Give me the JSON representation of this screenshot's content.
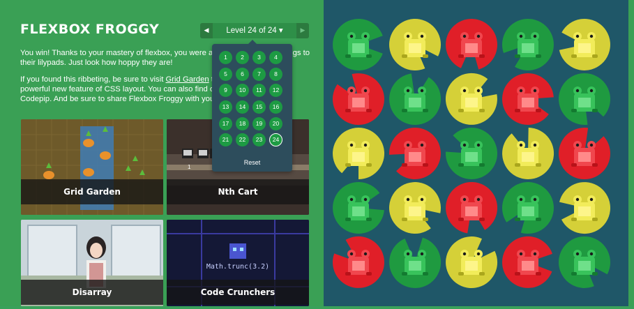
{
  "app": {
    "title": "FLEXBOX FROGGY"
  },
  "intro": {
    "p1": "You win! Thanks to your mastery of flexbox, you were able to help all of the frogs to their lilypads. Just look how hoppy they are!",
    "p2_before": "If you found this ribbeting, be sure to visit ",
    "p2_link": "Grid Garden",
    "p2_after": " to learn about another powerful new feature of CSS layout. You can also find other coding games at Codepip. And be sure to share Flexbox Froggy with your friends!"
  },
  "level_nav": {
    "prev_icon": "triangle-left-icon",
    "prev": "◀",
    "label": "Level 24 of 24 ▾",
    "next_icon": "triangle-right-icon",
    "next": "▶"
  },
  "level_menu": {
    "levels": [
      "1",
      "2",
      "3",
      "4",
      "5",
      "6",
      "7",
      "8",
      "9",
      "10",
      "11",
      "12",
      "13",
      "14",
      "15",
      "16",
      "17",
      "18",
      "19",
      "20",
      "21",
      "22",
      "23",
      "24"
    ],
    "current": "24",
    "reset": "Reset"
  },
  "cards": [
    {
      "id": "grid-garden",
      "label": "Grid Garden"
    },
    {
      "id": "nth-cart",
      "label": "Nth Cart"
    },
    {
      "id": "disarray",
      "label": "Disarray"
    },
    {
      "id": "code-crunchers",
      "label": "Code Crunchers",
      "code_text": "Math.trunc(3.2)"
    }
  ],
  "nth_cart_counter": "1",
  "pond": {
    "colors": {
      "green": "#1f9a40",
      "red": "#e01f28",
      "yellow": "#d5d038",
      "pond": "#1f5768"
    },
    "grid": [
      [
        "green",
        "yellow",
        "red",
        "green",
        "yellow"
      ],
      [
        "red",
        "green",
        "yellow",
        "red",
        "green"
      ],
      [
        "yellow",
        "red",
        "green",
        "yellow",
        "red"
      ],
      [
        "green",
        "yellow",
        "red",
        "green",
        "yellow"
      ],
      [
        "red",
        "green",
        "yellow",
        "red",
        "green"
      ]
    ]
  }
}
